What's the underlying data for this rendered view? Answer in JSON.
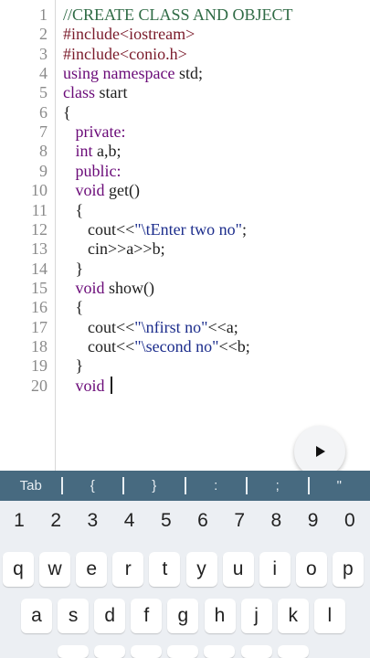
{
  "editor": {
    "lines": [
      {
        "num": "1",
        "tokens": [
          {
            "t": "//CREATE CLASS AND OBJECT",
            "c": "cm"
          }
        ]
      },
      {
        "num": "2",
        "tokens": [
          {
            "t": "#include<iostream>",
            "c": "pp"
          }
        ]
      },
      {
        "num": "3",
        "tokens": [
          {
            "t": "#include<conio.h>",
            "c": "pp"
          }
        ]
      },
      {
        "num": "4",
        "tokens": [
          {
            "t": "using namespace",
            "c": "kw"
          },
          {
            "t": " std;",
            "c": "pl"
          }
        ]
      },
      {
        "num": "5",
        "tokens": [
          {
            "t": "class",
            "c": "kw"
          },
          {
            "t": " start",
            "c": "pl"
          }
        ]
      },
      {
        "num": "6",
        "tokens": [
          {
            "t": "{",
            "c": "pl"
          }
        ]
      },
      {
        "num": "7",
        "tokens": [
          {
            "t": "   ",
            "c": "pl"
          },
          {
            "t": "private:",
            "c": "kw"
          }
        ]
      },
      {
        "num": "8",
        "tokens": [
          {
            "t": "   ",
            "c": "pl"
          },
          {
            "t": "int",
            "c": "kw"
          },
          {
            "t": " a,b;",
            "c": "pl"
          }
        ]
      },
      {
        "num": "9",
        "tokens": [
          {
            "t": "   ",
            "c": "pl"
          },
          {
            "t": "public:",
            "c": "kw"
          }
        ]
      },
      {
        "num": "10",
        "tokens": [
          {
            "t": "   ",
            "c": "pl"
          },
          {
            "t": "void",
            "c": "kw"
          },
          {
            "t": " get()",
            "c": "pl"
          }
        ]
      },
      {
        "num": "11",
        "tokens": [
          {
            "t": "   {",
            "c": "pl"
          }
        ]
      },
      {
        "num": "12",
        "tokens": [
          {
            "t": "      cout<<",
            "c": "pl"
          },
          {
            "t": "\"\\tEnter two no\"",
            "c": "str"
          },
          {
            "t": ";",
            "c": "pl"
          }
        ]
      },
      {
        "num": "13",
        "tokens": [
          {
            "t": "      cin>>a>>b;",
            "c": "pl"
          }
        ]
      },
      {
        "num": "14",
        "tokens": [
          {
            "t": "   }",
            "c": "pl"
          }
        ]
      },
      {
        "num": "15",
        "tokens": [
          {
            "t": "   ",
            "c": "pl"
          },
          {
            "t": "void",
            "c": "kw"
          },
          {
            "t": " show()",
            "c": "pl"
          }
        ]
      },
      {
        "num": "16",
        "tokens": [
          {
            "t": "   {",
            "c": "pl"
          }
        ]
      },
      {
        "num": "17",
        "tokens": [
          {
            "t": "      cout<<",
            "c": "pl"
          },
          {
            "t": "\"\\nfirst no\"",
            "c": "str"
          },
          {
            "t": "<<a;",
            "c": "pl"
          }
        ]
      },
      {
        "num": "18",
        "tokens": [
          {
            "t": "      cout<<",
            "c": "pl"
          },
          {
            "t": "\"\\second no\"",
            "c": "str"
          },
          {
            "t": "<<b;",
            "c": "pl"
          }
        ]
      },
      {
        "num": "19",
        "tokens": [
          {
            "t": "   }",
            "c": "pl"
          }
        ]
      },
      {
        "num": "20",
        "tokens": [
          {
            "t": "   ",
            "c": "pl"
          },
          {
            "t": "void",
            "c": "kw"
          },
          {
            "t": " ",
            "c": "pl"
          }
        ],
        "cursor": true
      }
    ]
  },
  "run_button": {
    "icon": "play-icon"
  },
  "symbol_bar": {
    "keys": [
      "Tab",
      "{",
      "}",
      ":",
      ";",
      "\""
    ]
  },
  "keyboard": {
    "numbers": [
      "1",
      "2",
      "3",
      "4",
      "5",
      "6",
      "7",
      "8",
      "9",
      "0"
    ],
    "row1": [
      "q",
      "w",
      "e",
      "r",
      "t",
      "y",
      "u",
      "i",
      "o",
      "p"
    ],
    "row2": [
      "a",
      "s",
      "d",
      "f",
      "g",
      "h",
      "j",
      "k",
      "l"
    ]
  },
  "colors": {
    "keyword": "#6a0a78",
    "preprocessor": "#7a1a2a",
    "string": "#1c2d8c",
    "comment": "#2f6b45",
    "symbol_bar": "#476a80",
    "keyboard_bg": "#eceff3"
  }
}
